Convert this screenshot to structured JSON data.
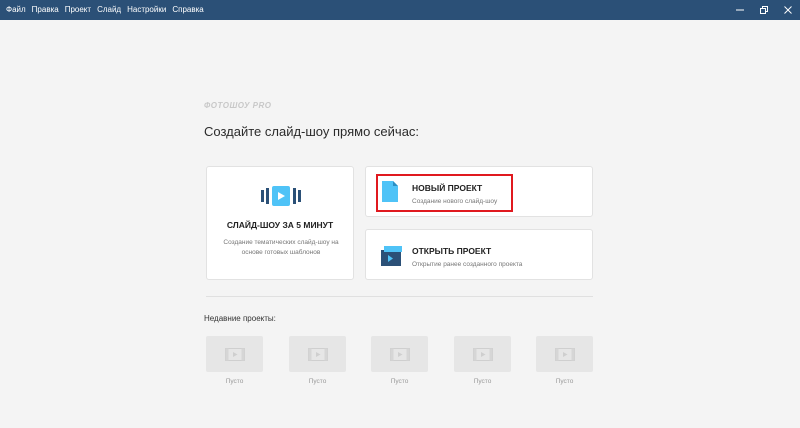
{
  "menu": [
    "Файл",
    "Правка",
    "Проект",
    "Слайд",
    "Настройки",
    "Справка"
  ],
  "brand": "ФОТОШОУ PRO",
  "headline": "Создайте слайд-шоу прямо сейчас:",
  "quick_card": {
    "title": "СЛАЙД-ШОУ ЗА 5 МИНУТ",
    "description": "Создание тематических слайд-шоу на основе готовых шаблонов"
  },
  "new_card": {
    "title": "НОВЫЙ ПРОЕКТ",
    "subtitle": "Создание нового слайд-шоу"
  },
  "open_card": {
    "title": "ОТКРЫТЬ ПРОЕКТ",
    "subtitle": "Открытие ранее созданного проекта"
  },
  "recent": {
    "title": "Недавние проекты:",
    "items": [
      {
        "label": "Пусто"
      },
      {
        "label": "Пусто"
      },
      {
        "label": "Пусто"
      },
      {
        "label": "Пусто"
      },
      {
        "label": "Пусто"
      }
    ]
  },
  "colors": {
    "titlebar": "#2b5077",
    "accent": "#4fc3f7",
    "highlight": "#e0191f"
  }
}
